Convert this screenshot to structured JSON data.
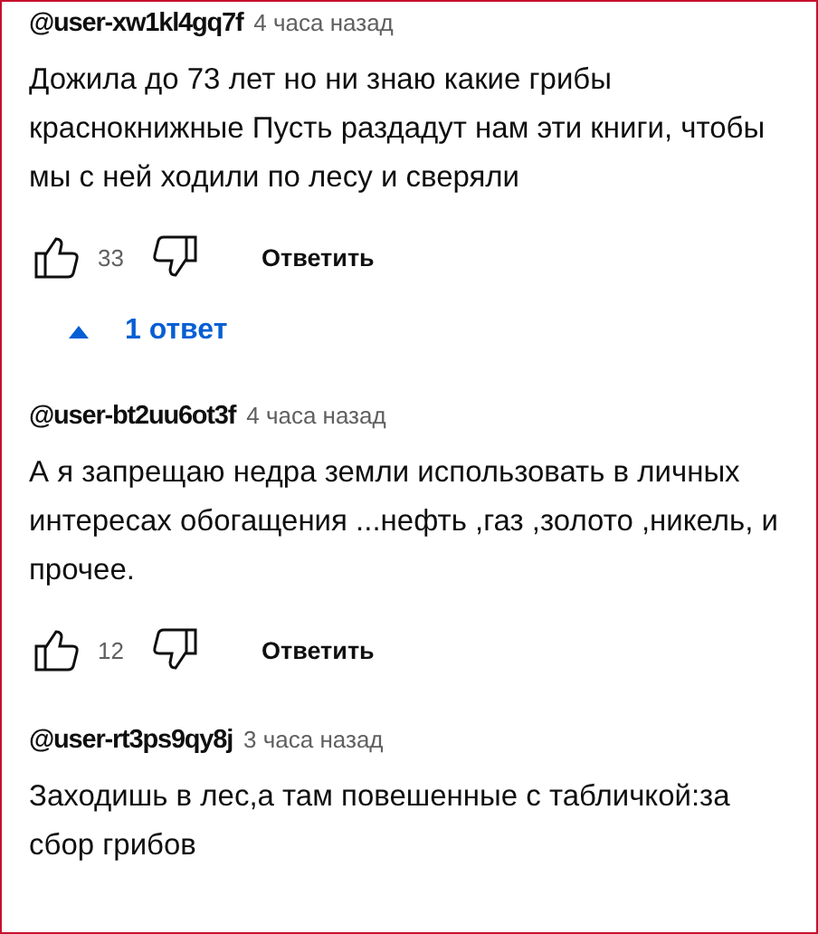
{
  "comments": [
    {
      "author": "@user-xw1kl4gq7f",
      "time": "4 часа назад",
      "text": "Дожила до 73 лет но ни знаю какие грибы краснокнижные Пусть раздадут нам эти книги, чтобы мы с ней ходили по лесу и сверяли",
      "likes": "33",
      "reply_button": "Ответить",
      "replies": {
        "label": "1 ответ",
        "expanded": true
      }
    },
    {
      "author": "@user-bt2uu6ot3f",
      "time": "4 часа назад",
      "text": "А я запрещаю недра земли использовать в личных интересах обогащения ...нефть ,газ ,золото ,никель, и прочее.",
      "likes": "12",
      "reply_button": "Ответить"
    },
    {
      "author": "@user-rt3ps9qy8j",
      "time": "3 часа назад",
      "text": "Заходишь в лес,а там повешенные с табличкой:за сбор грибов"
    }
  ]
}
